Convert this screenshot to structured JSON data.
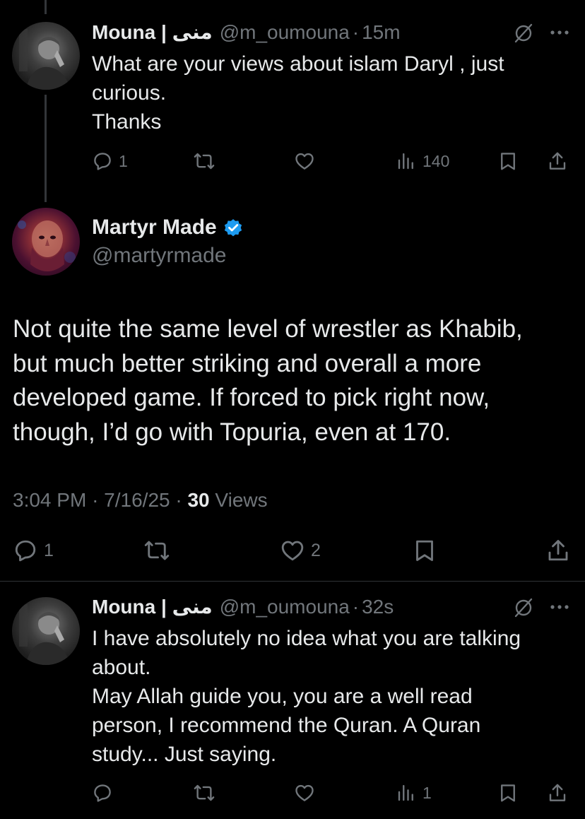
{
  "reply_1": {
    "name": "Mouna | منى",
    "handle": "@m_oumouna",
    "separator": "·",
    "time": "15m",
    "lines": [
      "What are your views about islam Daryl , just",
      "curious.",
      "Thanks"
    ],
    "actions": {
      "reply_count": "1",
      "repost_count": "",
      "like_count": "",
      "views_count": "140"
    }
  },
  "main_post": {
    "name": "Martyr Made",
    "handle": "@martyrmade",
    "lines": [
      "Not quite the same level of wrestler as Khabib,",
      "but much better striking and overall a more",
      "developed game. If forced to pick right now,",
      "though, I’d go with Topuria, even at 170."
    ],
    "time": "3:04 PM",
    "separator": "·",
    "date": "7/16/25",
    "separator_2": "·",
    "views_count": "30",
    "views_label": "Views",
    "actions": {
      "reply_count": "1",
      "repost_count": "",
      "like_count": "2"
    }
  },
  "reply_2": {
    "name": "Mouna | منى",
    "handle": "@m_oumouna",
    "separator": "·",
    "time": "32s",
    "lines": [
      "I have absolutely no idea what you are talking",
      "about.",
      "May Allah guide you, you are a well read",
      "person, I recommend the Quran. A Quran",
      "study... Just saying."
    ],
    "actions": {
      "reply_count": "",
      "repost_count": "",
      "like_count": "",
      "views_count": "1"
    }
  },
  "colors": {
    "background": "#000000",
    "text_primary": "#e7e9ea",
    "text_secondary": "#71767b",
    "verified_blue": "#1d9bf0",
    "divider": "#2f3336"
  },
  "icons": [
    "reply-icon",
    "repost-icon",
    "like-icon",
    "views-icon",
    "bookmark-icon",
    "share-icon",
    "grok-icon",
    "more-icon",
    "verified-badge-icon"
  ]
}
